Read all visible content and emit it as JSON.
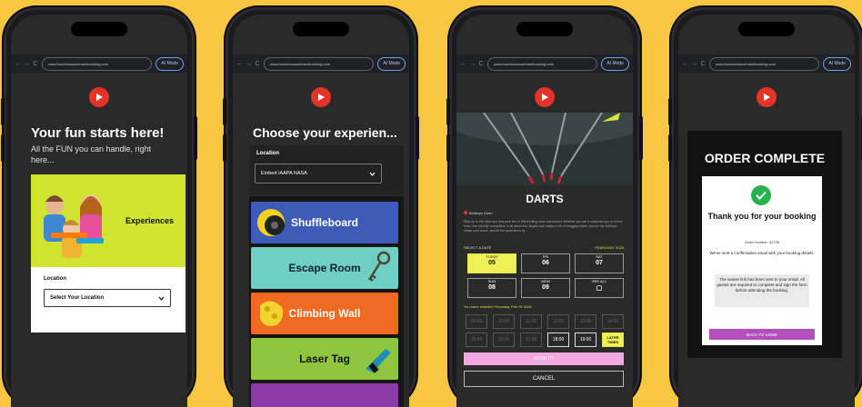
{
  "colors": {
    "background": "#f7c744",
    "brand_red": "#e6332a",
    "lime": "#cfe32f",
    "pink": "#f2a8e1",
    "purple": "#b54fbd",
    "success": "#26b34b"
  },
  "browser": {
    "ai_label": "AI Mode",
    "back": "←",
    "forward": "→",
    "reload": "C"
  },
  "screens": [
    {
      "url": "www.funmixaussortmentbooking.com",
      "title": "Your fun starts here!",
      "subtitle": "All the FUN you can handle, right here...",
      "card_label": "Experiences",
      "location_label": "Location",
      "location_select": "Select Your Location"
    },
    {
      "url": "www.funmixaussortmentbooking.com",
      "title": "Choose your experien...",
      "location_label": "Location",
      "location_select": "Embed IAAPA NASA",
      "tiles": [
        "Shuffleboard",
        "Escape Room",
        "Climbing Wall",
        "Laser Tag"
      ],
      "tile_colors": [
        "#3f5bb8",
        "#6fcfc2",
        "#f06a22",
        "#8fc63f"
      ]
    },
    {
      "url": "www.funmixaussortmentbooking.com",
      "title": "DARTS",
      "sub": "Bullseye Dash",
      "desc": "Step up to the oche and test your aim in this exciting darts showdown! Whether you are a seasoned pro or a first-timer, this friendly competition is all about fun, laughs and maybe a bit of bragging rights. Aim for the bullseye, chase your score, and let the good times fly.",
      "select_date": "SELECT A DATE",
      "month": "FEBRUARY 2026",
      "days": [
        {
          "dow": "TODAY",
          "num": "05"
        },
        {
          "dow": "FRI",
          "num": "06"
        },
        {
          "dow": "SAT",
          "num": "07"
        },
        {
          "dow": "SUN",
          "num": "08"
        },
        {
          "dow": "MON",
          "num": "09"
        },
        {
          "dow": "SEE ALL",
          "num": "▢"
        }
      ],
      "selected_text": "You have selected Thursday, Feb 05 2026",
      "times": [
        "09:00",
        "10:00",
        "11:00",
        "12:00",
        "13:00",
        "14:00",
        "15:00",
        "16:00",
        "17:00",
        "18:00",
        "19:00",
        "LATER TIMES"
      ],
      "book": "BOOK IT!",
      "cancel": "CANCEL"
    },
    {
      "url": "www.funmixaussortmentbooking.com",
      "title": "ORDER COMPLETE",
      "thanks": "Thank you for your booking",
      "order": "Order number: 02735",
      "confirm": "We've sent a confirmation email with your booking details.",
      "note": "The waiver link has been sent to your email. All guests are required to complete and sign the form before attending the booking.",
      "home": "BACK TO HOME"
    }
  ]
}
